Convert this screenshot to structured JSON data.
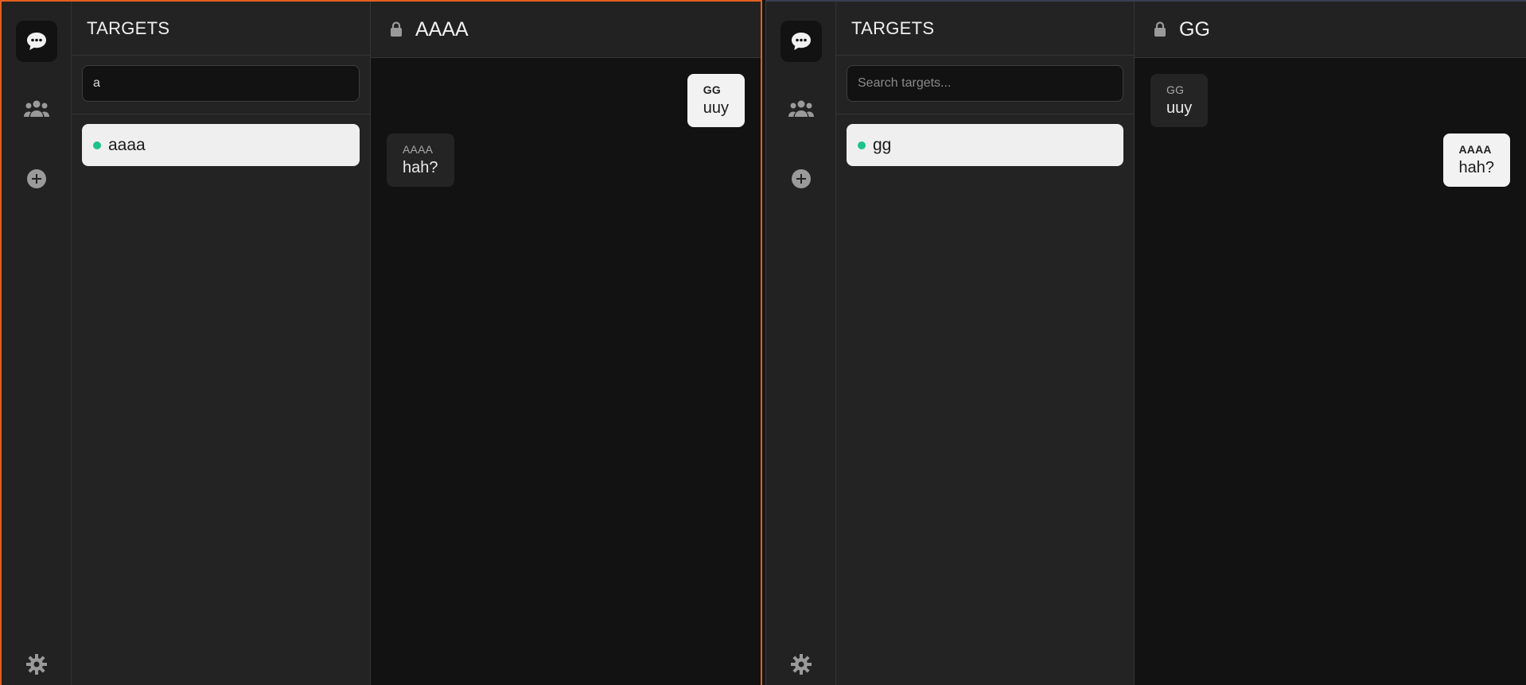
{
  "left": {
    "targets_title": "TARGETS",
    "search": {
      "value": "a",
      "placeholder": "Search targets..."
    },
    "targets": [
      {
        "label": "aaaa",
        "status": "online"
      }
    ],
    "chat": {
      "title": "AAAA",
      "messages": [
        {
          "sender": "GG",
          "text": "uuy",
          "side": "right",
          "style": "light"
        },
        {
          "sender": "AAAA",
          "text": "hah?",
          "side": "left",
          "style": "dark"
        }
      ]
    }
  },
  "right": {
    "targets_title": "TARGETS",
    "search": {
      "value": "",
      "placeholder": "Search targets..."
    },
    "targets": [
      {
        "label": "gg",
        "status": "online"
      }
    ],
    "chat": {
      "title": "GG",
      "messages": [
        {
          "sender": "GG",
          "text": "uuy",
          "side": "left",
          "style": "dark"
        },
        {
          "sender": "AAAA",
          "text": "hah?",
          "side": "right",
          "style": "light"
        }
      ]
    }
  },
  "icons": {
    "chat": "chat-bubble-icon",
    "people": "people-icon",
    "add": "plus-circle-icon",
    "settings": "gear-icon",
    "lock": "lock-icon"
  },
  "colors": {
    "active_window_border": "#e2601f",
    "online_dot": "#1ec28b",
    "selected_target_bg": "#efefef"
  }
}
